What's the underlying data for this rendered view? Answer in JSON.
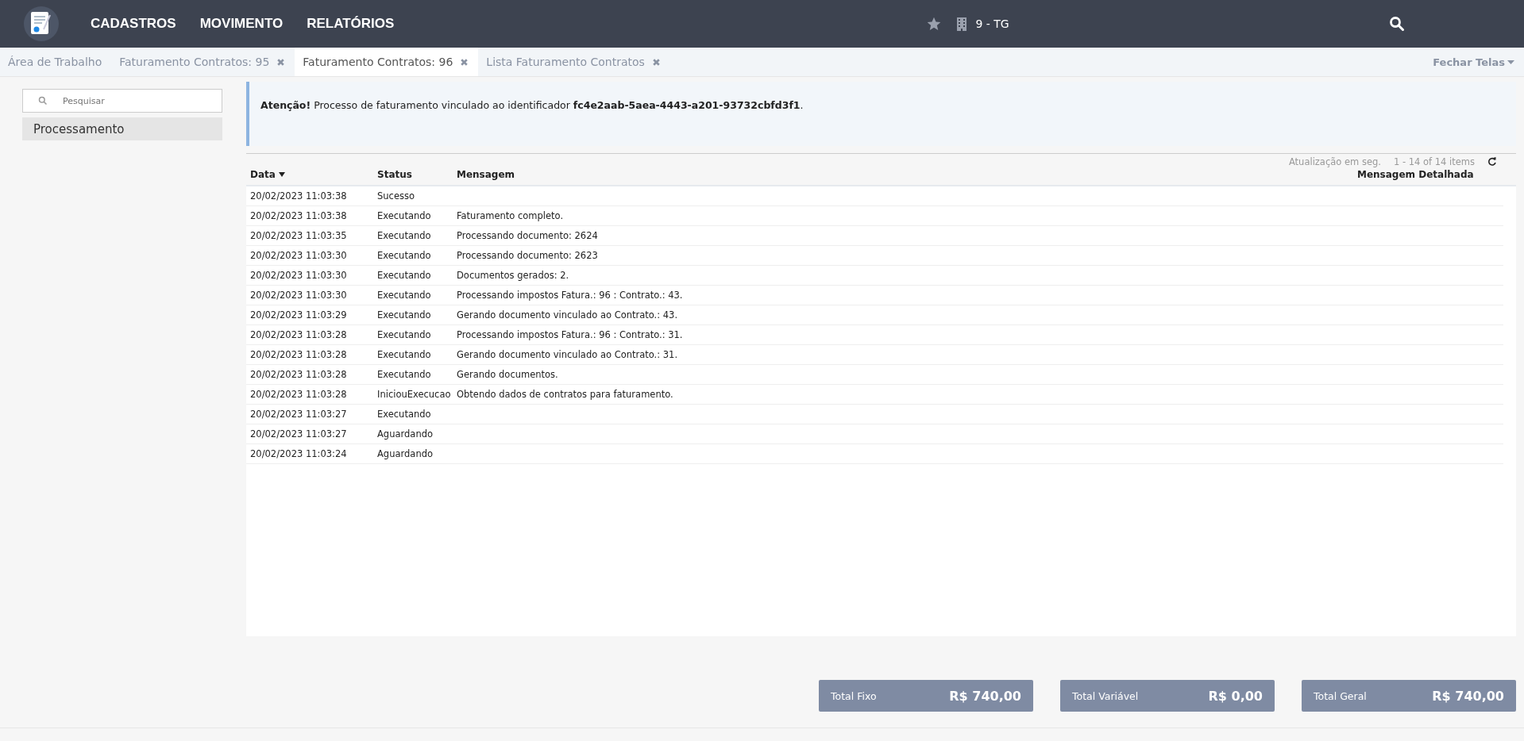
{
  "navbar": {
    "menu": [
      "CADASTROS",
      "MOVIMENTO",
      "RELATÓRIOS"
    ],
    "company": "9 - TG"
  },
  "tabs": [
    {
      "label": "Área de Trabalho",
      "selected": false,
      "closable": false
    },
    {
      "label": "Faturamento Contratos: 95",
      "selected": false,
      "closable": true
    },
    {
      "label": "Faturamento Contratos: 96",
      "selected": true,
      "closable": true
    },
    {
      "label": "Lista Faturamento Contratos",
      "selected": false,
      "closable": true
    }
  ],
  "close_screens": "Fechar Telas",
  "sidebar": {
    "search": {
      "placeholder": "Pesquisar"
    },
    "items": [
      {
        "label": "Processamento",
        "selected": true
      }
    ]
  },
  "alert": {
    "text": "**Atenção!** Processo de faturamento vinculado ao identificador **fc4e2aab-5aea-4443-a201-93732cbfd3f1**."
  },
  "table": {
    "toolbar": {
      "refresh_label": "Atualização em seg.",
      "pager": "1 - 14 of 14 items"
    },
    "columns": [
      "Data",
      "Status",
      "Mensagem",
      "Mensagem Detalhada"
    ],
    "rows": [
      [
        "20/02/2023 11:03:38",
        "Sucesso",
        ""
      ],
      [
        "20/02/2023 11:03:38",
        "Executando",
        "Faturamento completo."
      ],
      [
        "20/02/2023 11:03:35",
        "Executando",
        "Processando documento: 2624"
      ],
      [
        "20/02/2023 11:03:30",
        "Executando",
        "Processando documento: 2623"
      ],
      [
        "20/02/2023 11:03:30",
        "Executando",
        "Documentos gerados: 2."
      ],
      [
        "20/02/2023 11:03:30",
        "Executando",
        "Processando impostos Fatura.: 96 : Contrato.: 43."
      ],
      [
        "20/02/2023 11:03:29",
        "Executando",
        "Gerando documento vinculado ao Contrato.: 43."
      ],
      [
        "20/02/2023 11:03:28",
        "Executando",
        "Processando impostos Fatura.: 96 : Contrato.: 31."
      ],
      [
        "20/02/2023 11:03:28",
        "Executando",
        "Gerando documento vinculado ao Contrato.: 31."
      ],
      [
        "20/02/2023 11:03:28",
        "Executando",
        "Gerando documentos."
      ],
      [
        "20/02/2023 11:03:28",
        "IniciouExecucao",
        "Obtendo dados de contratos para faturamento."
      ],
      [
        "20/02/2023 11:03:27",
        "Executando",
        ""
      ],
      [
        "20/02/2023 11:03:27",
        "Aguardando",
        ""
      ],
      [
        "20/02/2023 11:03:24",
        "Aguardando",
        ""
      ]
    ]
  },
  "totals": [
    {
      "label": "Total Fixo",
      "value": "R$ 740,00"
    },
    {
      "label": "Total Variável",
      "value": "R$ 0,00"
    },
    {
      "label": "Total Geral",
      "value": "R$ 740,00"
    }
  ]
}
